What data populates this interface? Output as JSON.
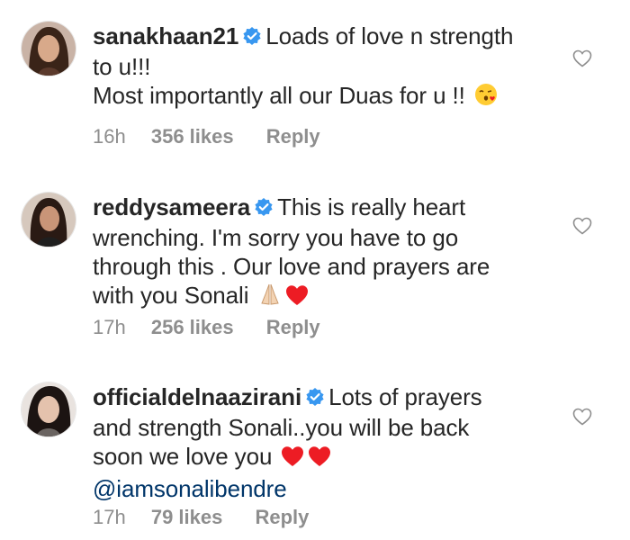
{
  "comments": [
    {
      "username": "sanakhaan21",
      "text_line1": "Loads of love n strength",
      "text_line2": "to u!!!",
      "text_line3": "Most importantly all our Duas for u !!",
      "emoji": "kissing-face-with-heart",
      "time": "16h",
      "likes": "356 likes",
      "reply": "Reply"
    },
    {
      "username": "reddysameera",
      "text_line1": "This is really heart",
      "text_line2": "wrenching. I'm sorry you have to go",
      "text_line3": "through this . Our love and prayers are",
      "text_line4": "with you Sonali",
      "emoji": "folded-hands-and-red-heart",
      "time": "17h",
      "likes": "256 likes",
      "reply": "Reply"
    },
    {
      "username": "officialdelnaazirani",
      "text_line1": "Lots of prayers",
      "text_line2": "and strength Sonali..you will be back",
      "text_line3": "soon we love you",
      "mention": "@iamsonalibendre",
      "emoji": "two-red-hearts",
      "time": "17h",
      "likes": "79 likes",
      "reply": "Reply"
    }
  ],
  "colors": {
    "text": "#262626",
    "meta": "#8e8e8e",
    "verified": "#3897f0",
    "mention": "#003569",
    "heart_red": "#ed1c24"
  }
}
